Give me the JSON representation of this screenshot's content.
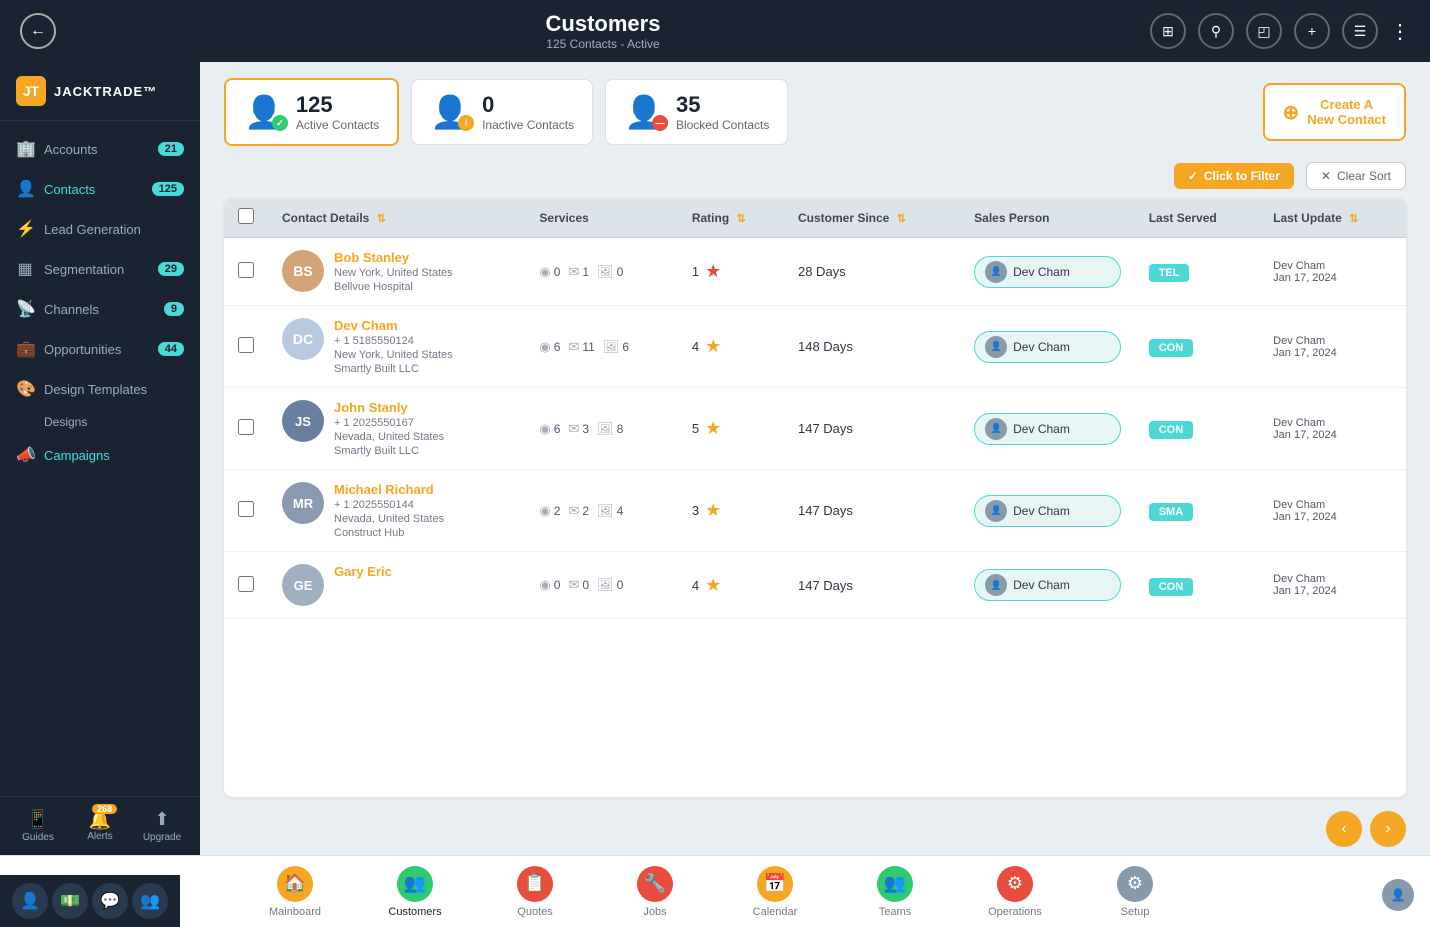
{
  "header": {
    "title": "Customers",
    "subtitle": "125 Contacts - Active",
    "back_label": "←"
  },
  "sidebar": {
    "logo_text": "JACKTRADE™",
    "logo_initial": "JT",
    "items": [
      {
        "id": "accounts",
        "label": "Accounts",
        "badge": "21",
        "icon": "🏢",
        "active": false
      },
      {
        "id": "contacts",
        "label": "Contacts",
        "badge": "125",
        "icon": "👤",
        "active": true
      },
      {
        "id": "lead-generation",
        "label": "Lead Generation",
        "badge": "",
        "icon": "⚡",
        "active": false
      },
      {
        "id": "segmentation",
        "label": "Segmentation",
        "badge": "29",
        "icon": "▦",
        "active": false
      },
      {
        "id": "channels",
        "label": "Channels",
        "badge": "9",
        "icon": "📡",
        "active": false
      },
      {
        "id": "opportunities",
        "label": "Opportunities",
        "badge": "44",
        "icon": "💼",
        "active": false
      },
      {
        "id": "design-templates",
        "label": "Design Templates",
        "badge": "",
        "icon": "🎨",
        "active": false
      },
      {
        "id": "designs",
        "label": "Designs",
        "badge": "",
        "icon": "",
        "sub": true,
        "active": false
      },
      {
        "id": "campaigns",
        "label": "Campaigns",
        "badge": "",
        "icon": "📣",
        "active": false
      }
    ],
    "bottom": [
      {
        "id": "guides",
        "label": "Guides",
        "icon": "📱"
      },
      {
        "id": "alerts",
        "label": "Alerts",
        "icon": "🔔",
        "badge": "268"
      },
      {
        "id": "upgrade",
        "label": "Upgrade",
        "icon": "⬆"
      }
    ]
  },
  "stats": {
    "active": {
      "number": "125",
      "label": "Active Contacts",
      "status": "green",
      "selected": true
    },
    "inactive": {
      "number": "0",
      "label": "Inactive Contacts",
      "status": "orange",
      "selected": false
    },
    "blocked": {
      "number": "35",
      "label": "Blocked Contacts",
      "status": "red",
      "selected": false
    },
    "create_btn": "Create A\nNew Contact"
  },
  "filter": {
    "filter_label": "Click to Filter",
    "clear_label": "Clear Sort"
  },
  "table": {
    "columns": [
      {
        "id": "contact",
        "label": "Contact Details",
        "sortable": true
      },
      {
        "id": "services",
        "label": "Services",
        "sortable": false
      },
      {
        "id": "rating",
        "label": "Rating",
        "sortable": true
      },
      {
        "id": "customer_since",
        "label": "Customer Since",
        "sortable": true
      },
      {
        "id": "sales_person",
        "label": "Sales Person",
        "sortable": false
      },
      {
        "id": "last_served",
        "label": "Last Served",
        "sortable": false
      },
      {
        "id": "last_update",
        "label": "Last Update",
        "sortable": true
      }
    ],
    "rows": [
      {
        "id": "bob-stanley",
        "initials": "BS",
        "avatar_color": "#d4a478",
        "name": "Bob Stanley",
        "location": "New York, United States",
        "company": "Bellvue Hospital",
        "phone": "",
        "svc_1": "0",
        "svc_2": "1",
        "svc_3": "0",
        "rating": "1",
        "star_color": "red",
        "customer_since": "28 Days",
        "sales_person": "Dev Cham",
        "last_served_tag": "TEL",
        "last_update_name": "Dev Cham",
        "last_update_date": "Jan 17, 2024",
        "has_photo": false
      },
      {
        "id": "dev-cham",
        "initials": "DC",
        "avatar_color": "#b8c8e0",
        "name": "Dev Cham",
        "location": "New York, United States",
        "company": "Smartly Built LLC",
        "phone": "+ 1 5185550124",
        "svc_1": "6",
        "svc_2": "11",
        "svc_3": "6",
        "rating": "4",
        "star_color": "gold",
        "customer_since": "148 Days",
        "sales_person": "Dev Cham",
        "last_served_tag": "CON",
        "last_update_name": "Dev Cham",
        "last_update_date": "Jan 17, 2024",
        "has_photo": false
      },
      {
        "id": "john-stanly",
        "initials": "JS",
        "avatar_color": "#6a7fa0",
        "name": "John Stanly",
        "location": "Nevada, United States",
        "company": "Smartly Built LLC",
        "phone": "+ 1 2025550167",
        "svc_1": "6",
        "svc_2": "3",
        "svc_3": "8",
        "rating": "5",
        "star_color": "gold",
        "customer_since": "147 Days",
        "sales_person": "Dev Cham",
        "last_served_tag": "CON",
        "last_update_name": "Dev Cham",
        "last_update_date": "Jan 17, 2024",
        "has_photo": true
      },
      {
        "id": "michael-richard",
        "initials": "MR",
        "avatar_color": "#8a9ab0",
        "name": "Michael Richard",
        "location": "Nevada, United States",
        "company": "Construct Hub",
        "phone": "+ 1 2025550144",
        "svc_1": "2",
        "svc_2": "2",
        "svc_3": "4",
        "rating": "3",
        "star_color": "gold",
        "customer_since": "147 Days",
        "sales_person": "Dev Cham",
        "last_served_tag": "SMA",
        "last_update_name": "Dev Cham",
        "last_update_date": "Jan 17, 2024",
        "has_photo": true
      },
      {
        "id": "gary-eric",
        "initials": "GE",
        "avatar_color": "#a0b0c0",
        "name": "Gary Eric",
        "location": "",
        "company": "",
        "phone": "",
        "svc_1": "0",
        "svc_2": "0",
        "svc_3": "0",
        "rating": "4",
        "star_color": "gold",
        "customer_since": "147 Days",
        "sales_person": "Dev Cham",
        "last_served_tag": "CON",
        "last_update_name": "Dev Cham",
        "last_update_date": "Jan 17, 2024",
        "has_photo": true
      }
    ]
  },
  "bottom_nav": [
    {
      "id": "mainboard",
      "label": "Mainboard",
      "icon": "🏠",
      "color": "bnav-mainboard",
      "active": false
    },
    {
      "id": "customers",
      "label": "Customers",
      "icon": "👥",
      "color": "bnav-customers",
      "active": true
    },
    {
      "id": "quotes",
      "label": "Quotes",
      "icon": "📋",
      "color": "bnav-quotes",
      "active": false
    },
    {
      "id": "jobs",
      "label": "Jobs",
      "icon": "🔧",
      "color": "bnav-jobs",
      "active": false
    },
    {
      "id": "calendar",
      "label": "Calendar",
      "icon": "📅",
      "color": "bnav-calendar",
      "active": false
    },
    {
      "id": "teams",
      "label": "Teams",
      "icon": "👥",
      "color": "bnav-teams",
      "active": false
    },
    {
      "id": "operations",
      "label": "Operations",
      "icon": "⚙",
      "color": "bnav-operations",
      "active": false
    },
    {
      "id": "setup",
      "label": "Setup",
      "icon": "⚙",
      "color": "bnav-setup",
      "active": false
    }
  ],
  "bottom_icons": [
    {
      "id": "person-icon",
      "icon": "👤"
    },
    {
      "id": "dollar-icon",
      "icon": "💵"
    },
    {
      "id": "chat-icon",
      "icon": "💬"
    },
    {
      "id": "group-icon",
      "icon": "👥"
    }
  ]
}
